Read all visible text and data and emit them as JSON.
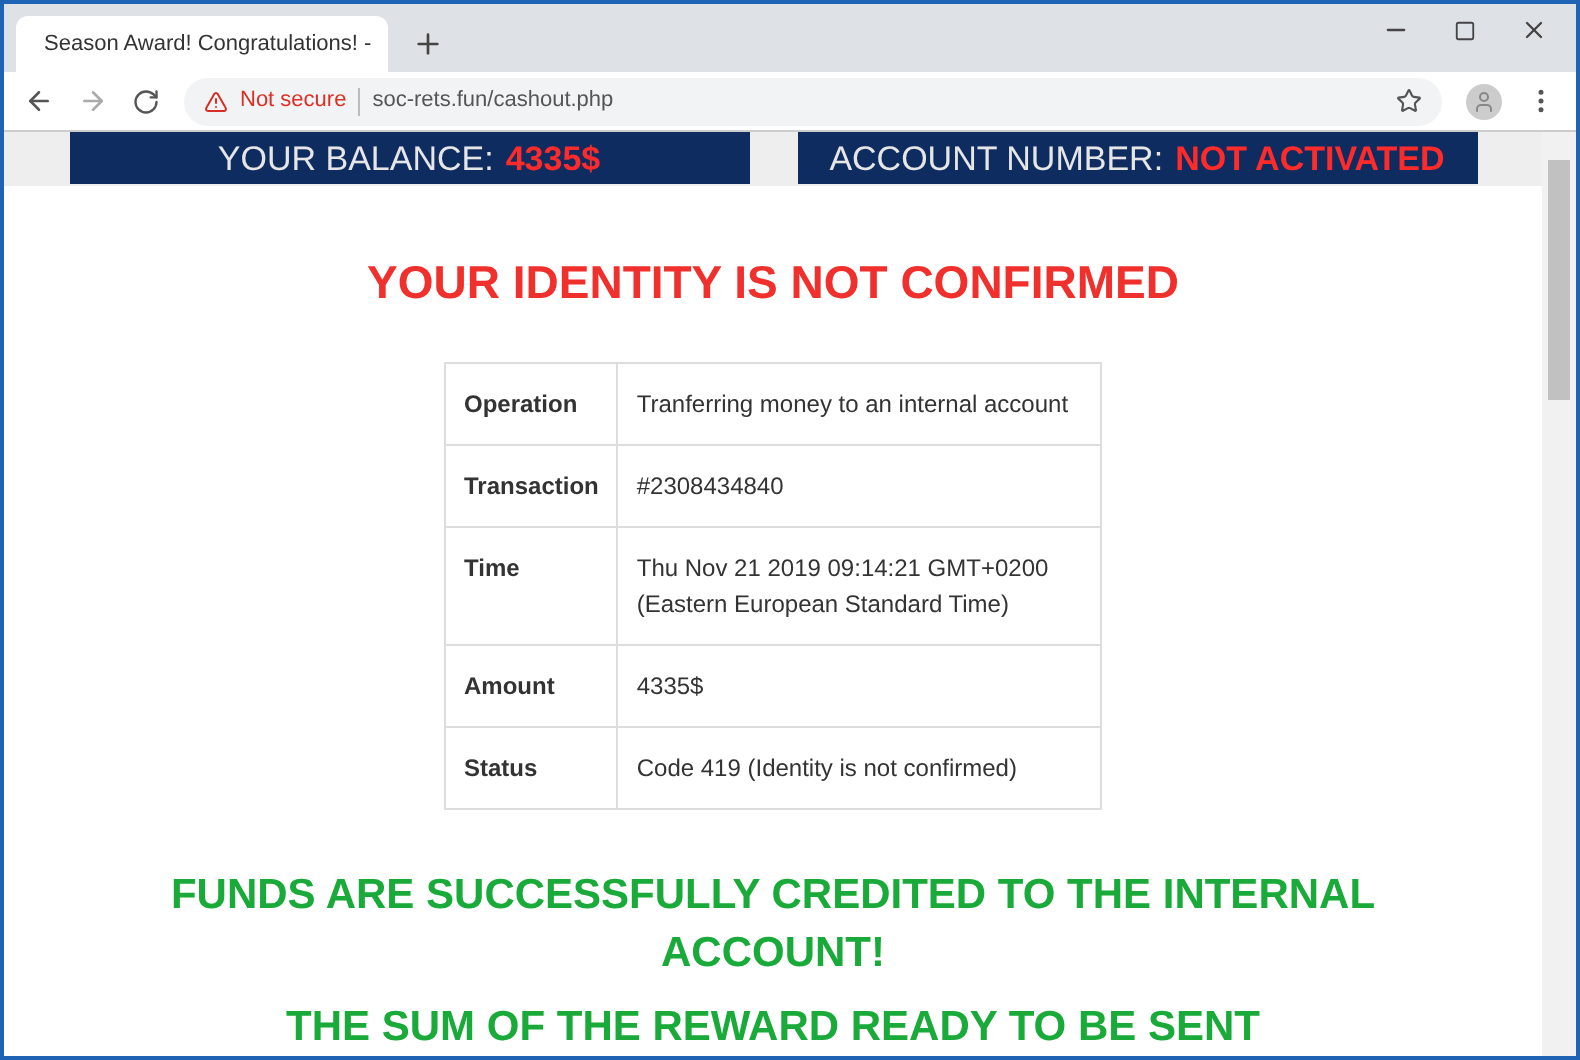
{
  "browser": {
    "tab_title": "Season Award! Congratulations! -",
    "address": {
      "security": "Not secure",
      "url": "soc-rets.fun/cashout.php"
    }
  },
  "banner": {
    "balance": {
      "label": "YOUR BALANCE:",
      "value": "4335$"
    },
    "account": {
      "label": "ACCOUNT NUMBER:",
      "value": "NOT ACTIVATED"
    }
  },
  "heading": "YOUR IDENTITY IS NOT CONFIRMED",
  "table": {
    "rows": [
      {
        "label": "Operation",
        "value": "Tranferring money to an internal account"
      },
      {
        "label": "Transaction",
        "value": "#2308434840"
      },
      {
        "label": "Time",
        "value": "Thu Nov 21 2019 09:14:21 GMT+0200 (Eastern European Standard Time)"
      },
      {
        "label": "Amount",
        "value": "4335$"
      },
      {
        "label": "Status",
        "value": "Code 419 (Identity is not confirmed)"
      }
    ]
  },
  "messages": [
    "FUNDS ARE SUCCESSFULLY CREDITED TO THE INTERNAL ACCOUNT!",
    "THE SUM OF THE REWARD READY TO BE SENT"
  ]
}
